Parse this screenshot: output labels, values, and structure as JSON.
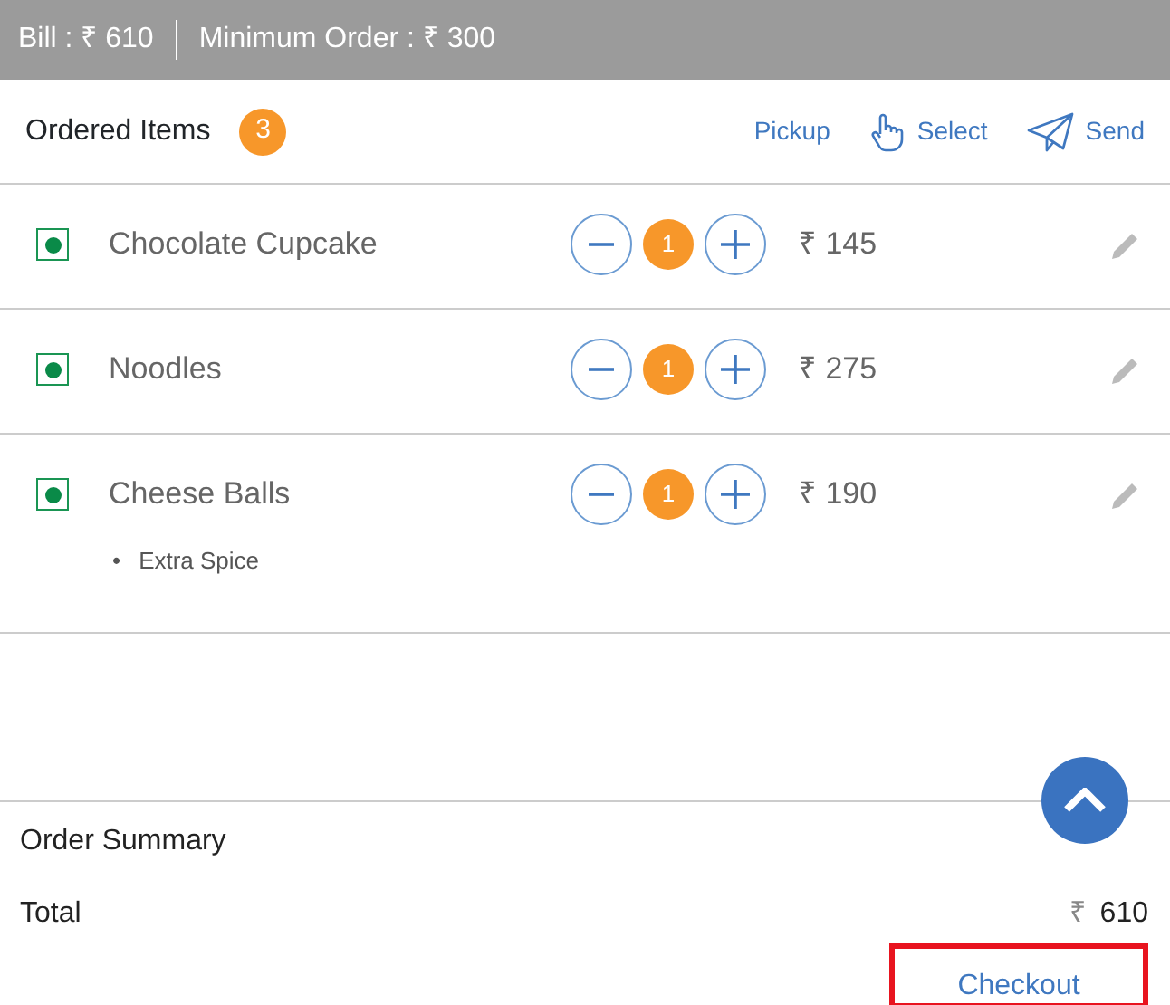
{
  "top_bar": {
    "bill": "Bill : ₹ 610",
    "minimum_order": "Minimum Order : ₹ 300"
  },
  "ordered_items": {
    "title": "Ordered Items",
    "count": "3",
    "actions": [
      {
        "label": "Pickup",
        "kind": "text"
      },
      {
        "label": "Select",
        "kind": "hand"
      },
      {
        "label": "Send",
        "kind": "plane"
      }
    ],
    "items": [
      {
        "name": "Chocolate Cupcake",
        "quantity": "1",
        "price": "₹ 145"
      },
      {
        "name": "Noodles",
        "quantity": "1",
        "price": "₹ 275"
      },
      {
        "name": "Cheese Balls",
        "quantity": "1",
        "price": "₹ 190",
        "notes": [
          {
            "marker": "•",
            "text": "Extra Spice"
          }
        ]
      }
    ]
  },
  "order_summary": {
    "title": "Order Summary",
    "total_label": "Total",
    "currency": "₹",
    "total": "610",
    "checkout": {
      "label": "Checkout",
      "highlighted": true
    }
  }
}
